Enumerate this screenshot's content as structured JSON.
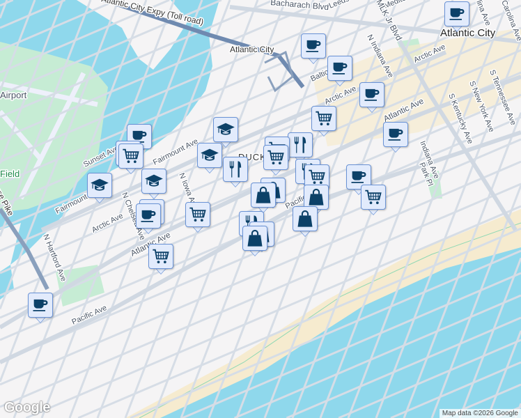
{
  "map": {
    "colors": {
      "water": "#8fd8ec",
      "land": "#f5f4f5",
      "park": "#c6ecd4",
      "beach": "#f6ebcf",
      "road": "#d6dde6",
      "highway": "#6f8ab0",
      "marker_bg": "#e2ebfc",
      "marker_border": "#6a93d6",
      "marker_icon": "#0c4168"
    },
    "labels": {
      "city": "Atlantic City",
      "district": "DUCK",
      "airport": "Airport",
      "field": "Field",
      "expressway": "Atlantic City Expy (Toll road)",
      "station": "Atlantic City",
      "bacharach": "Bacharach Blvd",
      "leeds": "Leeds",
      "mediterranean": "Medite",
      "mlk": "MLK Jr Blvd",
      "n_indiana": "N Indiana Ave",
      "arctic_east": "Arctic Ave",
      "arctic_mid": "Arctic Ave",
      "arctic_west": "Arctic Ave",
      "baltic": "Baltic",
      "atlantic_east": "Atlantic Ave",
      "atlantic_west": "Atlantic Ave",
      "pacific_east": "Pacific",
      "pacific_west": "Pacific Ave",
      "indiana": "Indiana Ave",
      "park_pl": "Park Pl",
      "s_kentucky": "S Kentucky Ave",
      "s_new_york": "S New York Ave",
      "s_tennessee": "S Tennessee Ave",
      "carolina": "Carolina Ave",
      "carolina2": "lina Ave",
      "sunset": "Sunset Ave",
      "fairmount_east": "Fairmount Ave",
      "fairmount_west": "Fairmount",
      "n_iowa": "N Iowa Ave",
      "n_chelsea": "N Chelsea Ave",
      "n_hartford": "N Hartford Ave",
      "black_horse": "Black Horse Pike"
    },
    "markers": [
      "coffee",
      "coffee",
      "coffee",
      "coffee",
      "cart",
      "coffee",
      "graduation",
      "coffee",
      "cart",
      "cart",
      "graduation",
      "restaurant",
      "restaurant",
      "cart",
      "cart",
      "restaurant",
      "cart",
      "coffee",
      "cart",
      "graduation",
      "graduation",
      "shopping",
      "shopping",
      "shopping",
      "shopping",
      "coffee",
      "coffee",
      "cart",
      "restaurant",
      "shopping",
      "shopping",
      "cart",
      "coffee"
    ],
    "attribution": "Map data ©2026 Google",
    "logo": "Google"
  }
}
